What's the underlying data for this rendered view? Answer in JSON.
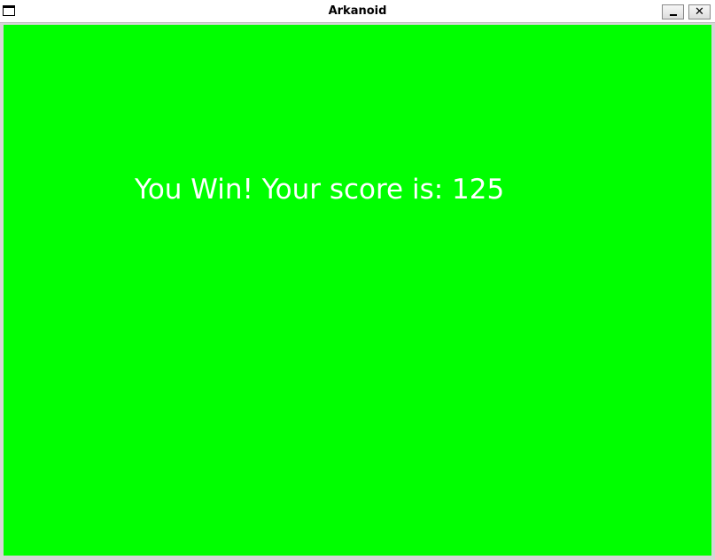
{
  "window": {
    "title": "Arkanoid",
    "icon": "window-icon",
    "controls": {
      "minimize_icon": "minimize-icon",
      "close_label": "✕"
    }
  },
  "game": {
    "background_color": "#00ff00",
    "text_color": "#ffffff",
    "message": "You Win! Your score is: 125",
    "score": 125
  }
}
